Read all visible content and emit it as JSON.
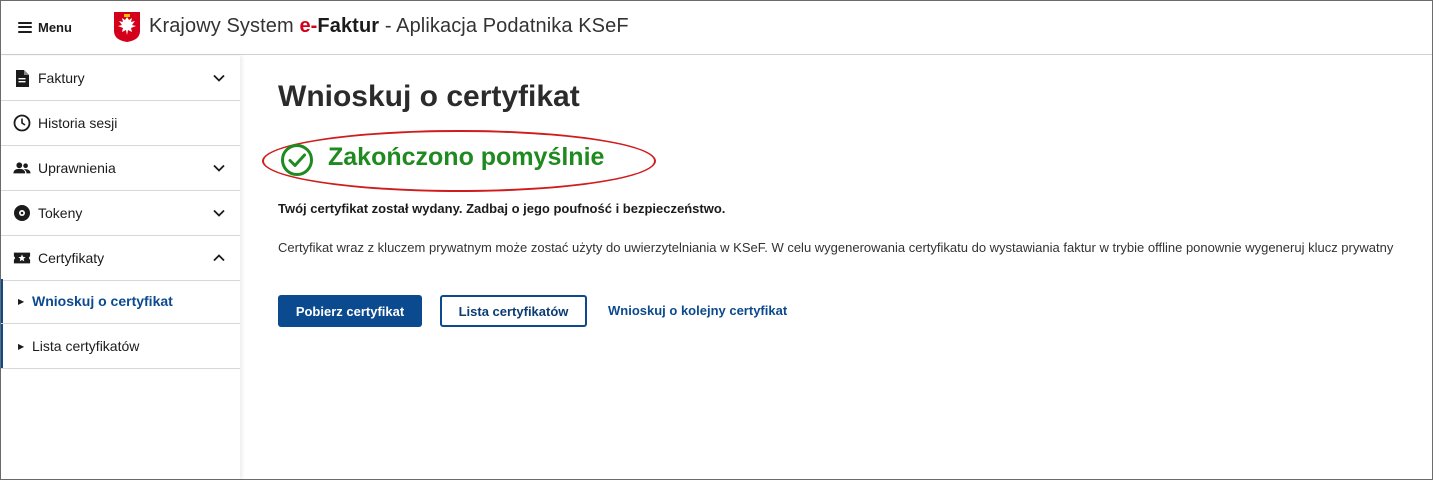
{
  "header": {
    "menu_label": "Menu",
    "title_prefix": "Krajowy System ",
    "title_e": "e-",
    "title_faktur": "Faktur",
    "title_suffix": " - Aplikacja Podatnika KSeF"
  },
  "sidebar": {
    "items": [
      {
        "label": "Faktury",
        "icon": "document-icon",
        "expandable": true,
        "expanded": false
      },
      {
        "label": "Historia sesji",
        "icon": "clock-icon",
        "expandable": false
      },
      {
        "label": "Uprawnienia",
        "icon": "users-icon",
        "expandable": true,
        "expanded": false
      },
      {
        "label": "Tokeny",
        "icon": "token-icon",
        "expandable": true,
        "expanded": false
      },
      {
        "label": "Certyfikaty",
        "icon": "certificate-icon",
        "expandable": true,
        "expanded": true
      }
    ],
    "subitems": [
      {
        "label": "Wnioskuj o certyfikat",
        "active": true
      },
      {
        "label": "Lista certyfikatów",
        "active": false
      }
    ]
  },
  "main": {
    "title": "Wnioskuj o certyfikat",
    "status": "Zakończono pomyślnie",
    "message_bold": "Twój certyfikat został wydany. Zadbaj o jego poufność i bezpieczeństwo.",
    "message_info": "Certyfikat wraz z kluczem prywatnym może zostać użyty do uwierzytelniania w KSeF. W celu wygenerowania certyfikatu do wystawiania faktur w trybie offline ponownie wygeneruj klucz prywatny",
    "buttons": {
      "download": "Pobierz certyfikat",
      "list": "Lista certyfikatów",
      "request_next": "Wnioskuj o kolejny certyfikat"
    }
  },
  "colors": {
    "primary": "#0b4a8f",
    "success": "#1f8a1f",
    "brand_red": "#d4001b",
    "annotation": "#d01c1c"
  }
}
